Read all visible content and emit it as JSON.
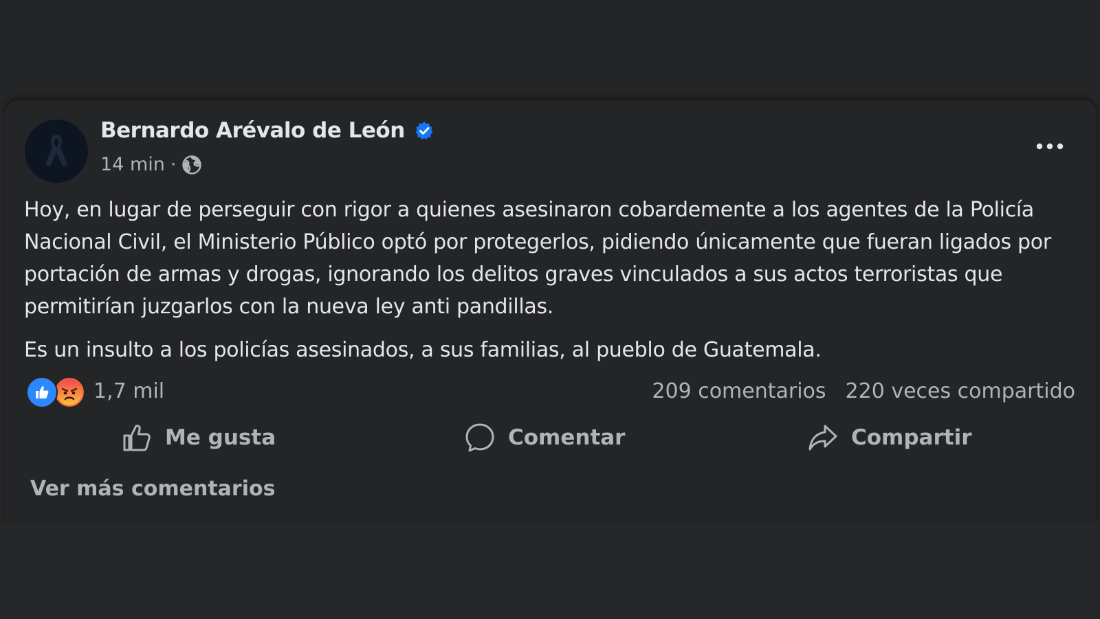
{
  "post": {
    "author": "Bernardo Arévalo de León",
    "time": "14 min",
    "separator": "·",
    "verified_icon": "verified-badge-icon",
    "privacy_icon": "globe-icon",
    "paragraphs": [
      "Hoy, en lugar de perseguir con rigor a quienes asesinaron cobardemente a los agentes de la Policía Nacional Civil, el Ministerio Público optó por protegerlos, pidiendo únicamente que fueran ligados por portación de armas y drogas, ignorando los delitos graves vinculados a sus actos terroristas que permitirían juzgarlos con la nueva ley anti pandillas.",
      "Es un insulto a los policías asesinados, a sus familias, al pueblo de Guatemala."
    ]
  },
  "reactions": {
    "icons": [
      "like-reaction-icon",
      "angry-reaction-icon"
    ],
    "count": "1,7 mil"
  },
  "stats": {
    "comments": "209 comentarios",
    "shares": "220 veces compartido"
  },
  "actions": {
    "like": "Me gusta",
    "comment": "Comentar",
    "share": "Compartir"
  },
  "more_comments": "Ver más comentarios",
  "colors": {
    "background": "#242526",
    "text_primary": "#e4e6eb",
    "text_secondary": "#b0b3b8",
    "verified_blue": "#1877f2",
    "like_blue": "#2d88ff",
    "angry_orange": "#f0613b"
  }
}
